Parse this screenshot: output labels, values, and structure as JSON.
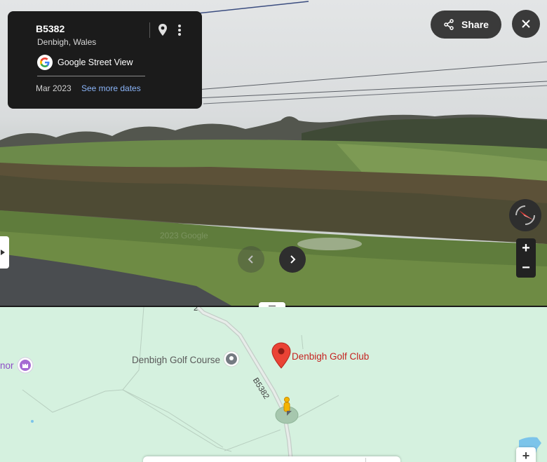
{
  "street_view": {
    "title": "B5382",
    "subtitle": "Denbigh, Wales",
    "provider_label": "Google Street View",
    "date": "Mar 2023",
    "see_more_dates": "See more dates",
    "share_label": "Share",
    "watermark": "2023 Google",
    "icons": [
      "map-pin-icon",
      "more-vert-icon",
      "google-logo-icon",
      "share-icon",
      "close-icon",
      "compass-icon",
      "chevron-left-icon",
      "chevron-right-icon"
    ],
    "zoom_in": "+",
    "zoom_out": "−"
  },
  "map": {
    "labels": {
      "golf_course": "Denbigh Golf Course",
      "golf_club": "Denbigh Golf Club",
      "manor_partial": "nor",
      "road": "B5382",
      "road_partial": "2"
    },
    "zoom_in": "+",
    "colors": {
      "map_background": "#d5f1df",
      "club_pin": "#ea4335",
      "club_label": "#c5221f",
      "poi_purple": "#a66bd3",
      "pegman": "#f4b400"
    }
  }
}
